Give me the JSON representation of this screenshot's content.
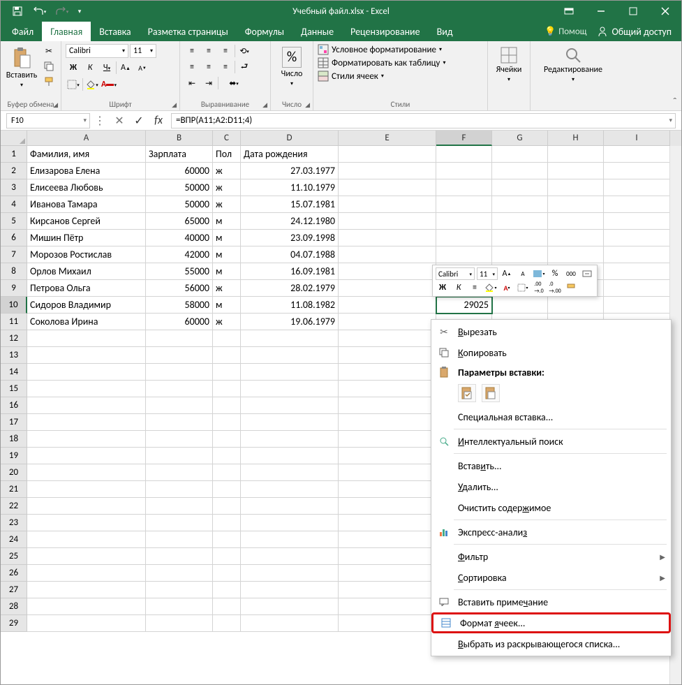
{
  "titlebar": {
    "title": "Учебный файл.xlsx - Excel"
  },
  "tabs": {
    "file": "Файл",
    "items": [
      "Главная",
      "Вставка",
      "Разметка страницы",
      "Формулы",
      "Данные",
      "Рецензирование",
      "Вид"
    ],
    "active_index": 0,
    "tell_me": "Помощ",
    "share": "Общий доступ"
  },
  "ribbon": {
    "clipboard": {
      "paste": "Вставить",
      "label": "Буфер обмена"
    },
    "font": {
      "name": "Calibri",
      "size": "11",
      "label": "Шрифт",
      "bold": "Ж",
      "italic": "К",
      "underline": "Ч"
    },
    "alignment": {
      "label": "Выравнивание"
    },
    "number": {
      "big": "Число",
      "label": "Число"
    },
    "styles": {
      "cond": "Условное форматирование",
      "table": "Форматировать как таблицу",
      "cell": "Стили ячеек",
      "label": "Стили"
    },
    "cells": {
      "big": "Ячейки"
    },
    "editing": {
      "big": "Редактирование"
    }
  },
  "formula_bar": {
    "name_box": "F10",
    "formula": "=ВПР(A11;A2:D11;4)"
  },
  "columns": [
    "A",
    "B",
    "C",
    "D",
    "E",
    "F",
    "G",
    "H",
    "I"
  ],
  "selected_col": "F",
  "selected_row": 10,
  "rows": [
    {
      "n": 1,
      "A": "Фамилия, имя",
      "B": "Зарплата",
      "C": "Пол",
      "D": "Дата рождения",
      "E": "",
      "F": ""
    },
    {
      "n": 2,
      "A": "Елизарова Елена",
      "B": "60000",
      "C": "ж",
      "D": "27.03.1977"
    },
    {
      "n": 3,
      "A": "Елисеева Любовь",
      "B": "50000",
      "C": "ж",
      "D": "11.10.1979"
    },
    {
      "n": 4,
      "A": "Иванова Тамара",
      "B": "50000",
      "C": "ж",
      "D": "15.07.1981"
    },
    {
      "n": 5,
      "A": "Кирсанов Сергей",
      "B": "65000",
      "C": "м",
      "D": "24.12.1980"
    },
    {
      "n": 6,
      "A": "Мишин Пётр",
      "B": "40000",
      "C": "м",
      "D": "23.09.1998"
    },
    {
      "n": 7,
      "A": "Морозов Ростислав",
      "B": "42000",
      "C": "м",
      "D": "04.07.1988"
    },
    {
      "n": 8,
      "A": "Орлов Михаил",
      "B": "55000",
      "C": "м",
      "D": "16.09.1981"
    },
    {
      "n": 9,
      "A": "Петрова Ольга",
      "B": "56000",
      "C": "ж",
      "D": "28.02.1979"
    },
    {
      "n": 10,
      "A": "Сидоров Владимир",
      "B": "58000",
      "C": "м",
      "D": "11.08.1982",
      "F": "29025"
    },
    {
      "n": 11,
      "A": "Соколова Ирина",
      "B": "60000",
      "C": "ж",
      "D": "19.06.1979"
    }
  ],
  "empty_rows_after": 18,
  "mini_toolbar": {
    "font": "Calibri",
    "size": "11",
    "bold": "Ж",
    "italic": "К",
    "percent": "%",
    "thousands": "000"
  },
  "context_menu": {
    "cut": "Вырезать",
    "copy": "Копировать",
    "paste_header": "Параметры вставки:",
    "paste_special": "Специальная вставка...",
    "smart_lookup": "Интеллектуальный поиск",
    "insert": "Вставить...",
    "delete": "Удалить...",
    "clear": "Очистить содержимое",
    "quick_analysis": "Экспресс-анализ",
    "filter": "Фильтр",
    "sort": "Сортировка",
    "insert_comment": "Вставить примечание",
    "format_cells": "Формат ячеек...",
    "pick_list": "Выбрать из раскрывающегося списка..."
  }
}
